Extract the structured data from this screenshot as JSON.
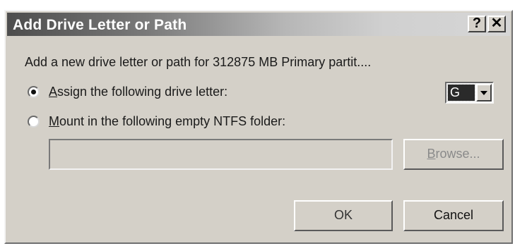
{
  "dialog": {
    "title": "Add Drive Letter or Path",
    "help_label": "?",
    "close_label": "✕",
    "description": "Add a new drive letter or path for 312875 MB  Primary partit....",
    "assign_option": {
      "accel": "A",
      "rest": "ssign the following drive letter:",
      "selected": true
    },
    "mount_option": {
      "accel": "M",
      "rest": "ount in the following empty NTFS folder:",
      "selected": false
    },
    "drive_letter": {
      "value": "G"
    },
    "folder_path": {
      "value": ""
    },
    "browse_button": {
      "accel": "B",
      "rest": "rowse..."
    },
    "ok_label": "OK",
    "cancel_label": "Cancel"
  }
}
